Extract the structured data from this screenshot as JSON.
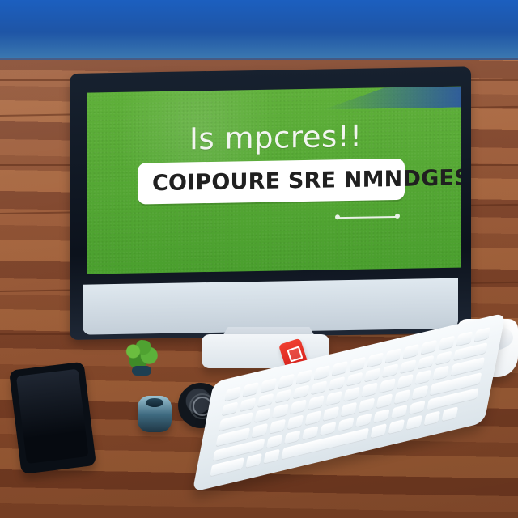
{
  "screen": {
    "title": "Is mpcres!!",
    "prompt": "COIPOURE SRE NMNDGES?"
  }
}
